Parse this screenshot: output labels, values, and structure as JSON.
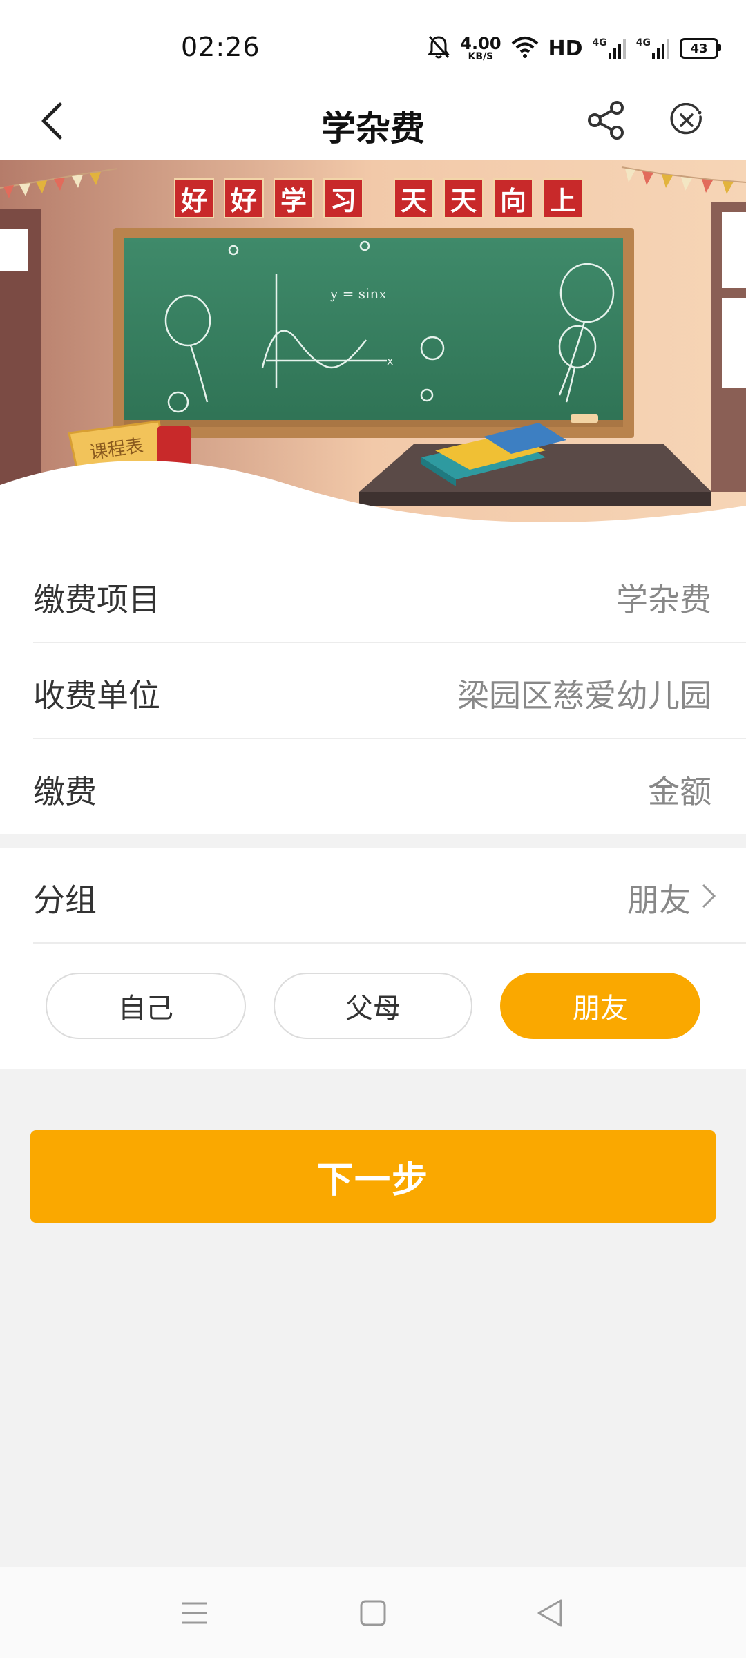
{
  "status_bar": {
    "time": "02:26",
    "net_speed_value": "4.00",
    "net_speed_unit": "KB/S",
    "hd_label": "HD",
    "signal1_label": "4G",
    "signal2_label": "4G",
    "battery": "43"
  },
  "header": {
    "title": "学杂费",
    "back_icon": "back-arrow-icon",
    "share_icon": "share-icon",
    "close_icon": "close-circle-icon"
  },
  "banner": {
    "slogan_left": [
      "好",
      "好",
      "学",
      "习"
    ],
    "slogan_right": [
      "天",
      "天",
      "向",
      "上"
    ],
    "blackboard_formula": "y = sinx",
    "sign_text": "课程表"
  },
  "details": [
    {
      "label": "缴费项目",
      "value": "学杂费"
    },
    {
      "label": "收费单位",
      "value": "梁园区慈爱幼儿园"
    },
    {
      "label": "缴费",
      "value": "金额"
    }
  ],
  "group": {
    "label": "分组",
    "value": "朋友",
    "options": [
      "自己",
      "父母",
      "朋友"
    ],
    "selected_index": 2
  },
  "next_button": "下一步",
  "colors": {
    "accent": "#faa800",
    "background": "#f2f2f2"
  },
  "nav_bar": {
    "menu_icon": "menu-icon",
    "home_icon": "home-square-icon",
    "back_icon": "back-triangle-icon"
  }
}
